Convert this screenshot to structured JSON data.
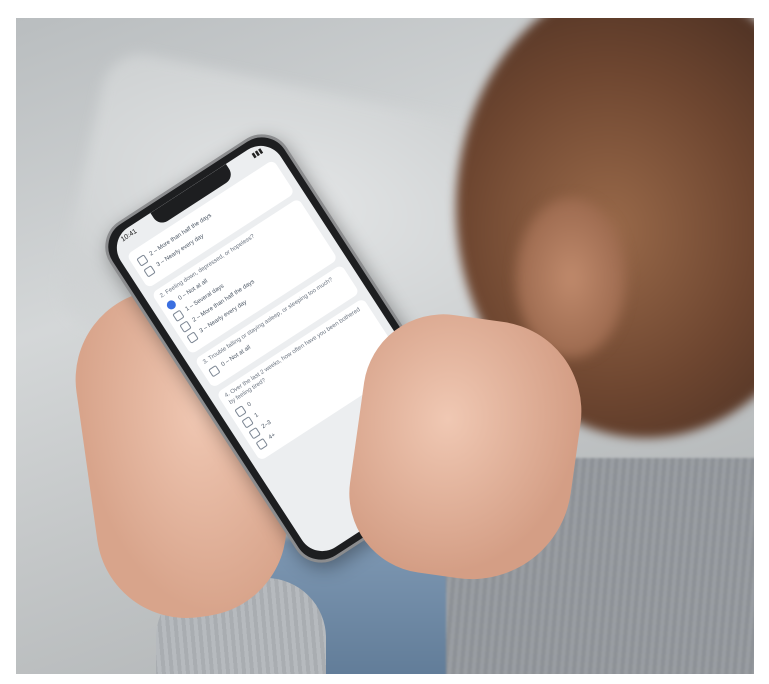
{
  "scene": {
    "description_alt": "Person holding a smartphone showing a survey"
  },
  "phone": {
    "status_time": "10:41",
    "status_right": "▮▮▮",
    "questions": [
      {
        "options": [
          {
            "label": "2 – More than half the days",
            "selected": false
          },
          {
            "label": "3 – Nearly every day",
            "selected": false
          }
        ]
      },
      {
        "prompt": "2. Feeling down, depressed, or hopeless?",
        "options": [
          {
            "label": "0 – Not at all",
            "selected": true
          },
          {
            "label": "1 – Several days",
            "selected": false
          },
          {
            "label": "2 – More than half the days",
            "selected": false
          },
          {
            "label": "3 – Nearly every day",
            "selected": false
          }
        ]
      },
      {
        "prompt": "3. Trouble falling or staying asleep, or sleeping too much?",
        "options": [
          {
            "label": "0 – Not at all",
            "selected": false
          }
        ]
      },
      {
        "prompt": "4. Over the last 2 weeks, how often have you been bothered by feeling tired?",
        "options": [
          {
            "label": "0",
            "selected": false
          },
          {
            "label": "1",
            "selected": false
          },
          {
            "label": "2–3",
            "selected": false
          },
          {
            "label": "4+",
            "selected": false
          }
        ]
      }
    ]
  }
}
